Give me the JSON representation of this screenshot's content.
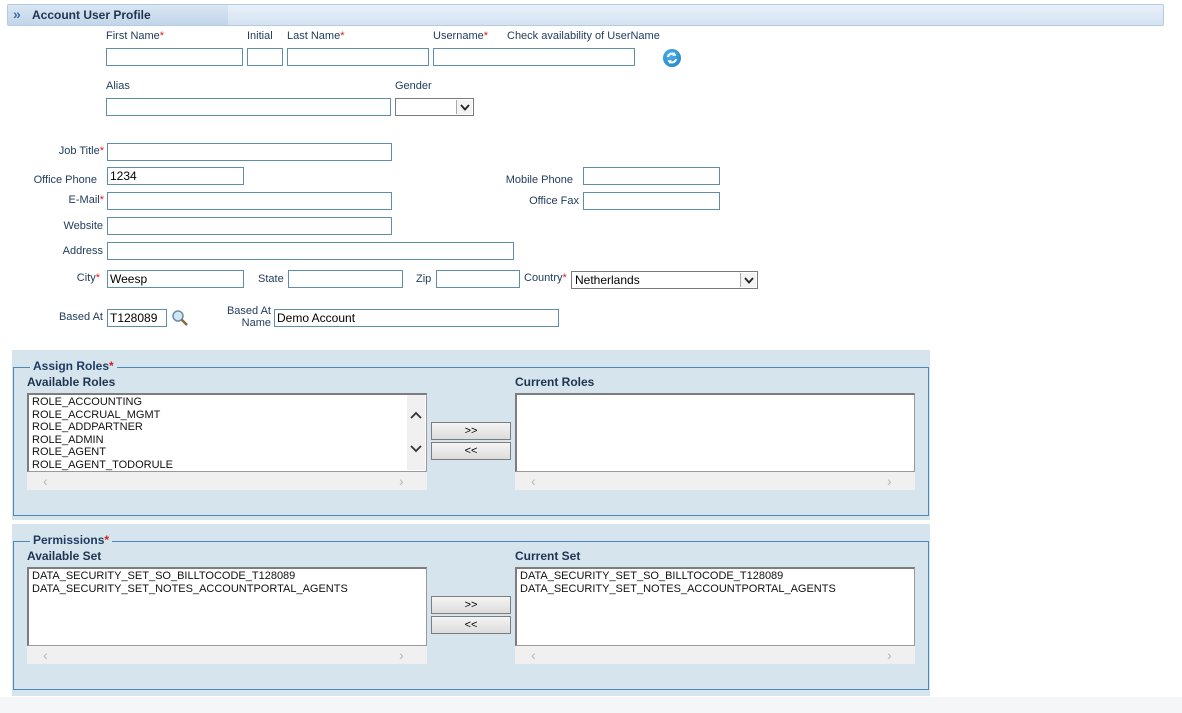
{
  "header": {
    "title": "Account User Profile",
    "arrow_glyph": "»"
  },
  "form": {
    "first_name": {
      "label": "First Name",
      "value": ""
    },
    "initial": {
      "label": "Initial",
      "value": ""
    },
    "last_name": {
      "label": "Last Name",
      "value": ""
    },
    "username": {
      "label": "Username",
      "value": ""
    },
    "check_availability": {
      "label": "Check availability of UserName"
    },
    "alias": {
      "label": "Alias",
      "value": ""
    },
    "gender": {
      "label": "Gender",
      "value": ""
    },
    "job_title": {
      "label": "Job Title",
      "value": ""
    },
    "office_phone": {
      "label": "Office Phone",
      "value": "1234"
    },
    "mobile_phone": {
      "label": "Mobile Phone",
      "value": ""
    },
    "email": {
      "label": "E-Mail",
      "value": ""
    },
    "office_fax": {
      "label": "Office Fax",
      "value": ""
    },
    "website": {
      "label": "Website",
      "value": ""
    },
    "address": {
      "label": "Address",
      "value": ""
    },
    "city": {
      "label": "City",
      "value": "Weesp"
    },
    "state": {
      "label": "State",
      "value": ""
    },
    "zip": {
      "label": "Zip",
      "value": ""
    },
    "country": {
      "label": "Country",
      "value": "Netherlands"
    },
    "based_at": {
      "label": "Based At",
      "value": "T128089"
    },
    "based_at_name": {
      "label_line1": "Based At",
      "label_line2": "Name",
      "value": "Demo Account"
    },
    "required_mark": "*"
  },
  "roles": {
    "legend": "Assign Roles",
    "available_label": "Available Roles",
    "current_label": "Current Roles",
    "available": [
      "ROLE_ACCOUNTING",
      "ROLE_ACCRUAL_MGMT",
      "ROLE_ADDPARTNER",
      "ROLE_ADMIN",
      "ROLE_AGENT",
      "ROLE_AGENT_TODORULE"
    ],
    "current": [],
    "add_button": ">>",
    "remove_button": "<<"
  },
  "permissions": {
    "legend": "Permissions",
    "available_label": "Available Set",
    "current_label": "Current Set",
    "available": [
      "DATA_SECURITY_SET_SO_BILLTOCODE_T128089",
      "DATA_SECURITY_SET_NOTES_ACCOUNTPORTAL_AGENTS"
    ],
    "current": [
      "DATA_SECURITY_SET_SO_BILLTOCODE_T128089",
      "DATA_SECURITY_SET_NOTES_ACCOUNTPORTAL_AGENTS"
    ],
    "add_button": ">>",
    "remove_button": "<<"
  },
  "icons": {
    "refresh": "refresh-icon",
    "search": "magnifier-icon",
    "dropdown": "chevron-down-icon"
  },
  "colors": {
    "label_text": "#1e3a5a",
    "required": "#d42020",
    "panel_bg": "#d6e4ee",
    "fieldset_border": "#4b88b5",
    "input_border": "#5f8fa6"
  }
}
